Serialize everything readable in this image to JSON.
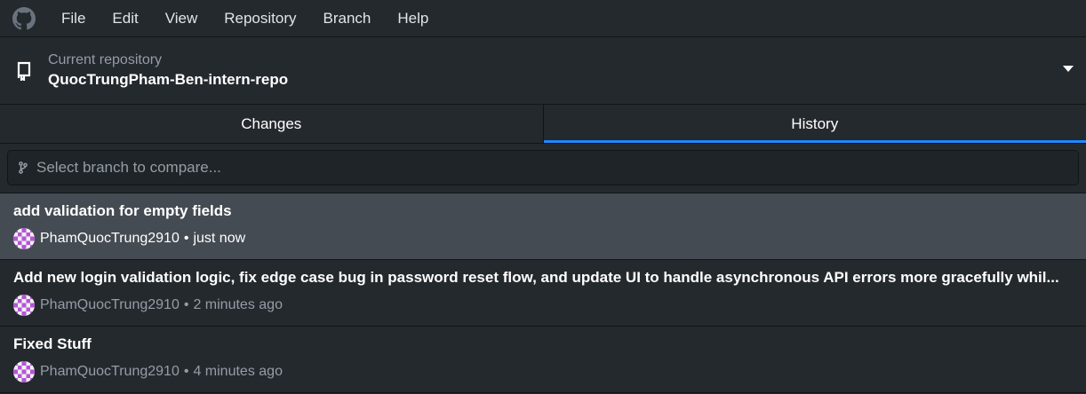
{
  "menu": {
    "items": [
      "File",
      "Edit",
      "View",
      "Repository",
      "Branch",
      "Help"
    ]
  },
  "repository": {
    "label": "Current repository",
    "name": "QuocTrungPham-Ben-intern-repo"
  },
  "tabs": [
    {
      "label": "Changes",
      "active": false
    },
    {
      "label": "History",
      "active": true
    }
  ],
  "compare": {
    "placeholder": "Select branch to compare..."
  },
  "commits": [
    {
      "title": "add validation for empty fields",
      "author": "PhamQuocTrung2910",
      "time": "just now",
      "selected": true
    },
    {
      "title": "Add new login validation logic, fix edge case bug in password reset flow, and update UI to handle asynchronous API errors more gracefully whil...",
      "author": "PhamQuocTrung2910",
      "time": "2 minutes ago",
      "selected": false
    },
    {
      "title": "Fixed Stuff",
      "author": "PhamQuocTrung2910",
      "time": "4 minutes ago",
      "selected": false
    }
  ],
  "meta_separator": "•",
  "colors": {
    "background": "#24292e",
    "selected_row": "#454b53",
    "accent": "#2188ff",
    "avatar_primary": "#b455d6"
  },
  "icons": {
    "logo": "github-logo-icon",
    "repo": "repo-icon",
    "caret": "chevron-down-icon",
    "branch": "branch-icon",
    "avatar": "identicon-avatar"
  }
}
